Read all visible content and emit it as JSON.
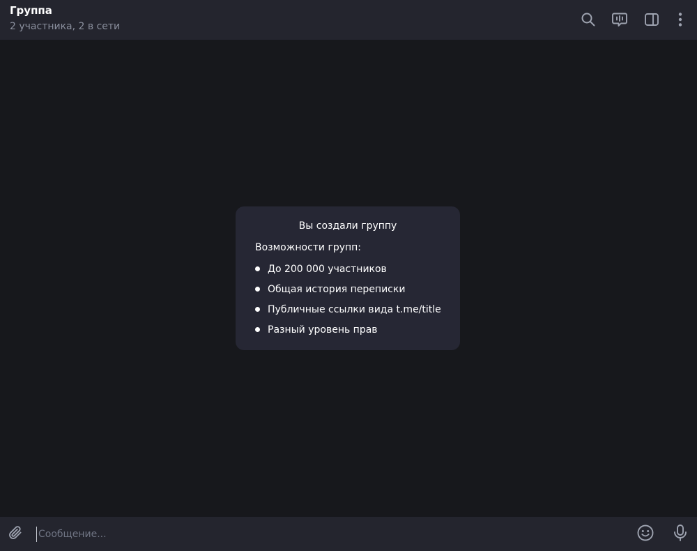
{
  "header": {
    "title": "Группа",
    "subtitle": "2 участника, 2 в сети",
    "icons": [
      "search-icon",
      "video-chat-icon",
      "sidebar-toggle-icon",
      "more-vertical-icon"
    ]
  },
  "service_card": {
    "title": "Вы создали группу",
    "subtitle": "Возможности групп:",
    "items": [
      "До 200 000 участников",
      "Общая история переписки",
      "Публичные ссылки вида t.me/title",
      "Разный уровень прав"
    ]
  },
  "composer": {
    "placeholder": "Сообщение...",
    "value": "",
    "icons": [
      "attach-icon",
      "emoji-icon",
      "microphone-icon"
    ]
  },
  "colors": {
    "background": "#17181c",
    "header_bg": "#24252e",
    "card_bg": "#262734",
    "text": "#ffffff",
    "muted_text": "#8a8f9d",
    "icon": "#9ea3b0"
  }
}
